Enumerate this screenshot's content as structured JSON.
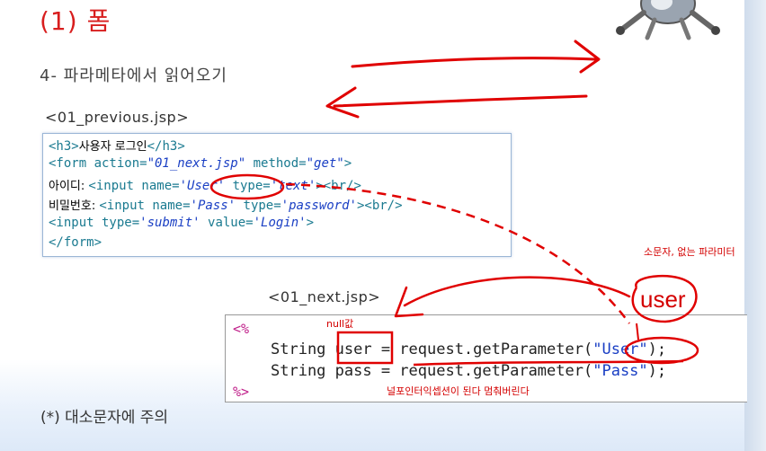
{
  "slide": {
    "title": "(1) 폼",
    "subtitle": "4- 파라메타에서 읽어오기",
    "previous_file_label": "<01_previous.jsp>",
    "next_file_label": "<01_next.jsp>",
    "footer_note": "(*) 대소문자에 주의",
    "accent_color": "#d81e1e",
    "annotation_color": "#e00000"
  },
  "previous_code": {
    "line1_tag_open": "<h3>",
    "line1_text": "사용자 로그인",
    "line1_tag_close": "</h3>",
    "line2_form": "<form action=",
    "line2_action": "\"01_next.jsp\"",
    "line2_method_attr": " method=",
    "line2_method": "\"get\"",
    "line2_end": ">",
    "line3_label": "아이디: ",
    "line3_input": "<input name=",
    "line3_name": "'User'",
    "line3_type_attr": " type=",
    "line3_type": "'text'",
    "line3_end": "><br/>",
    "line4_label": "비밀번호: ",
    "line4_input": "<input name=",
    "line4_name": "'Pass'",
    "line4_type_attr": " type=",
    "line4_type": "'password'",
    "line4_end": "><br/>",
    "line5_input": "<input type=",
    "line5_type": "'submit'",
    "line5_value_attr": " value=",
    "line5_value": "'Login'",
    "line5_end": ">",
    "line6": "</form>"
  },
  "next_code": {
    "open_tag": "<%",
    "close_tag": "%>",
    "line1_prefix": "String user = request.getParameter(",
    "line1_arg": "\"User\"",
    "line1_suffix": ");",
    "line2_prefix": "String pass = request.getParameter(",
    "line2_arg": "\"Pass\"",
    "line2_suffix": ");"
  },
  "annotations": {
    "lowercase_note": "소문자, 없는 파라미터",
    "user_handwritten": "user",
    "null_note": "null값",
    "exception_note": "널포인터익셉션이 된다 멈춰버린다"
  },
  "icons": {
    "robot": "robot-mascot-icon"
  }
}
